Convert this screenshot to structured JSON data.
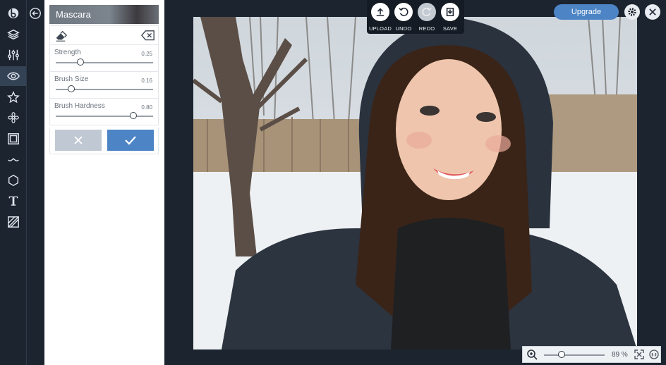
{
  "sidebar": {
    "icons": [
      "logo-icon",
      "layers-icon",
      "sliders-icon",
      "eye-icon",
      "star-icon",
      "flower-icon",
      "frame-icon",
      "mustache-icon",
      "shape-icon",
      "text-icon",
      "texture-icon"
    ],
    "active": "eye-icon"
  },
  "panel": {
    "title": "Mascara",
    "controls": [
      {
        "label": "Strength",
        "value": "0.25",
        "level": 0.25
      },
      {
        "label": "Brush Size",
        "value": "0.16",
        "level": 0.16
      },
      {
        "label": "Brush Hardness",
        "value": "0.80",
        "level": 0.8
      }
    ]
  },
  "toolbar": {
    "upload_label": "UPLOAD",
    "undo_label": "UNDO",
    "redo_label": "REDO",
    "save_label": "SAVE"
  },
  "header": {
    "upgrade_label": "Upgrade"
  },
  "zoom": {
    "value_label": "89 %",
    "level": 0.89
  },
  "colors": {
    "accent": "#4c84c5",
    "background": "#1c2430"
  }
}
